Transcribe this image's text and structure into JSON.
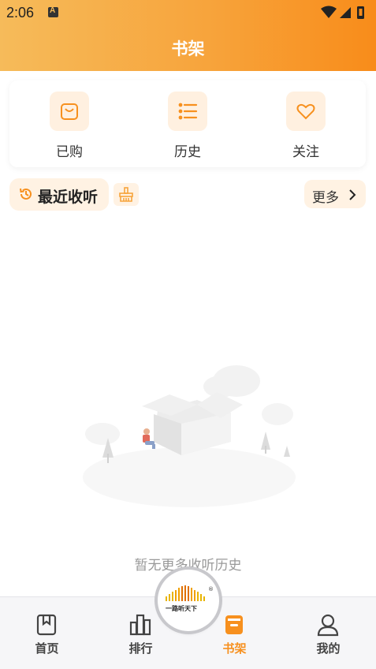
{
  "status_bar": {
    "time": "2:06",
    "a_badge": "A"
  },
  "header": {
    "title": "书架"
  },
  "quick_actions": [
    {
      "label": "已购",
      "icon": "shopping-bag-icon"
    },
    {
      "label": "历史",
      "icon": "list-icon"
    },
    {
      "label": "关注",
      "icon": "heart-icon"
    }
  ],
  "recent": {
    "title": "最近收听",
    "more_label": "更多"
  },
  "empty_state": {
    "message": "暂无更多收听历史"
  },
  "tabs": [
    {
      "label": "首页",
      "icon": "bookmark-book-icon",
      "active": false
    },
    {
      "label": "排行",
      "icon": "bar-chart-icon",
      "active": false
    },
    {
      "label": "书架",
      "icon": "bookshelf-icon",
      "active": true
    },
    {
      "label": "我的",
      "icon": "user-icon",
      "active": false
    }
  ],
  "center_logo": {
    "text": "一路听天下",
    "registered": "®"
  },
  "colors": {
    "accent": "#f7901e",
    "header_start": "#f6bb5a",
    "header_end": "#f88c1a",
    "pill_bg": "#fff2e3"
  }
}
